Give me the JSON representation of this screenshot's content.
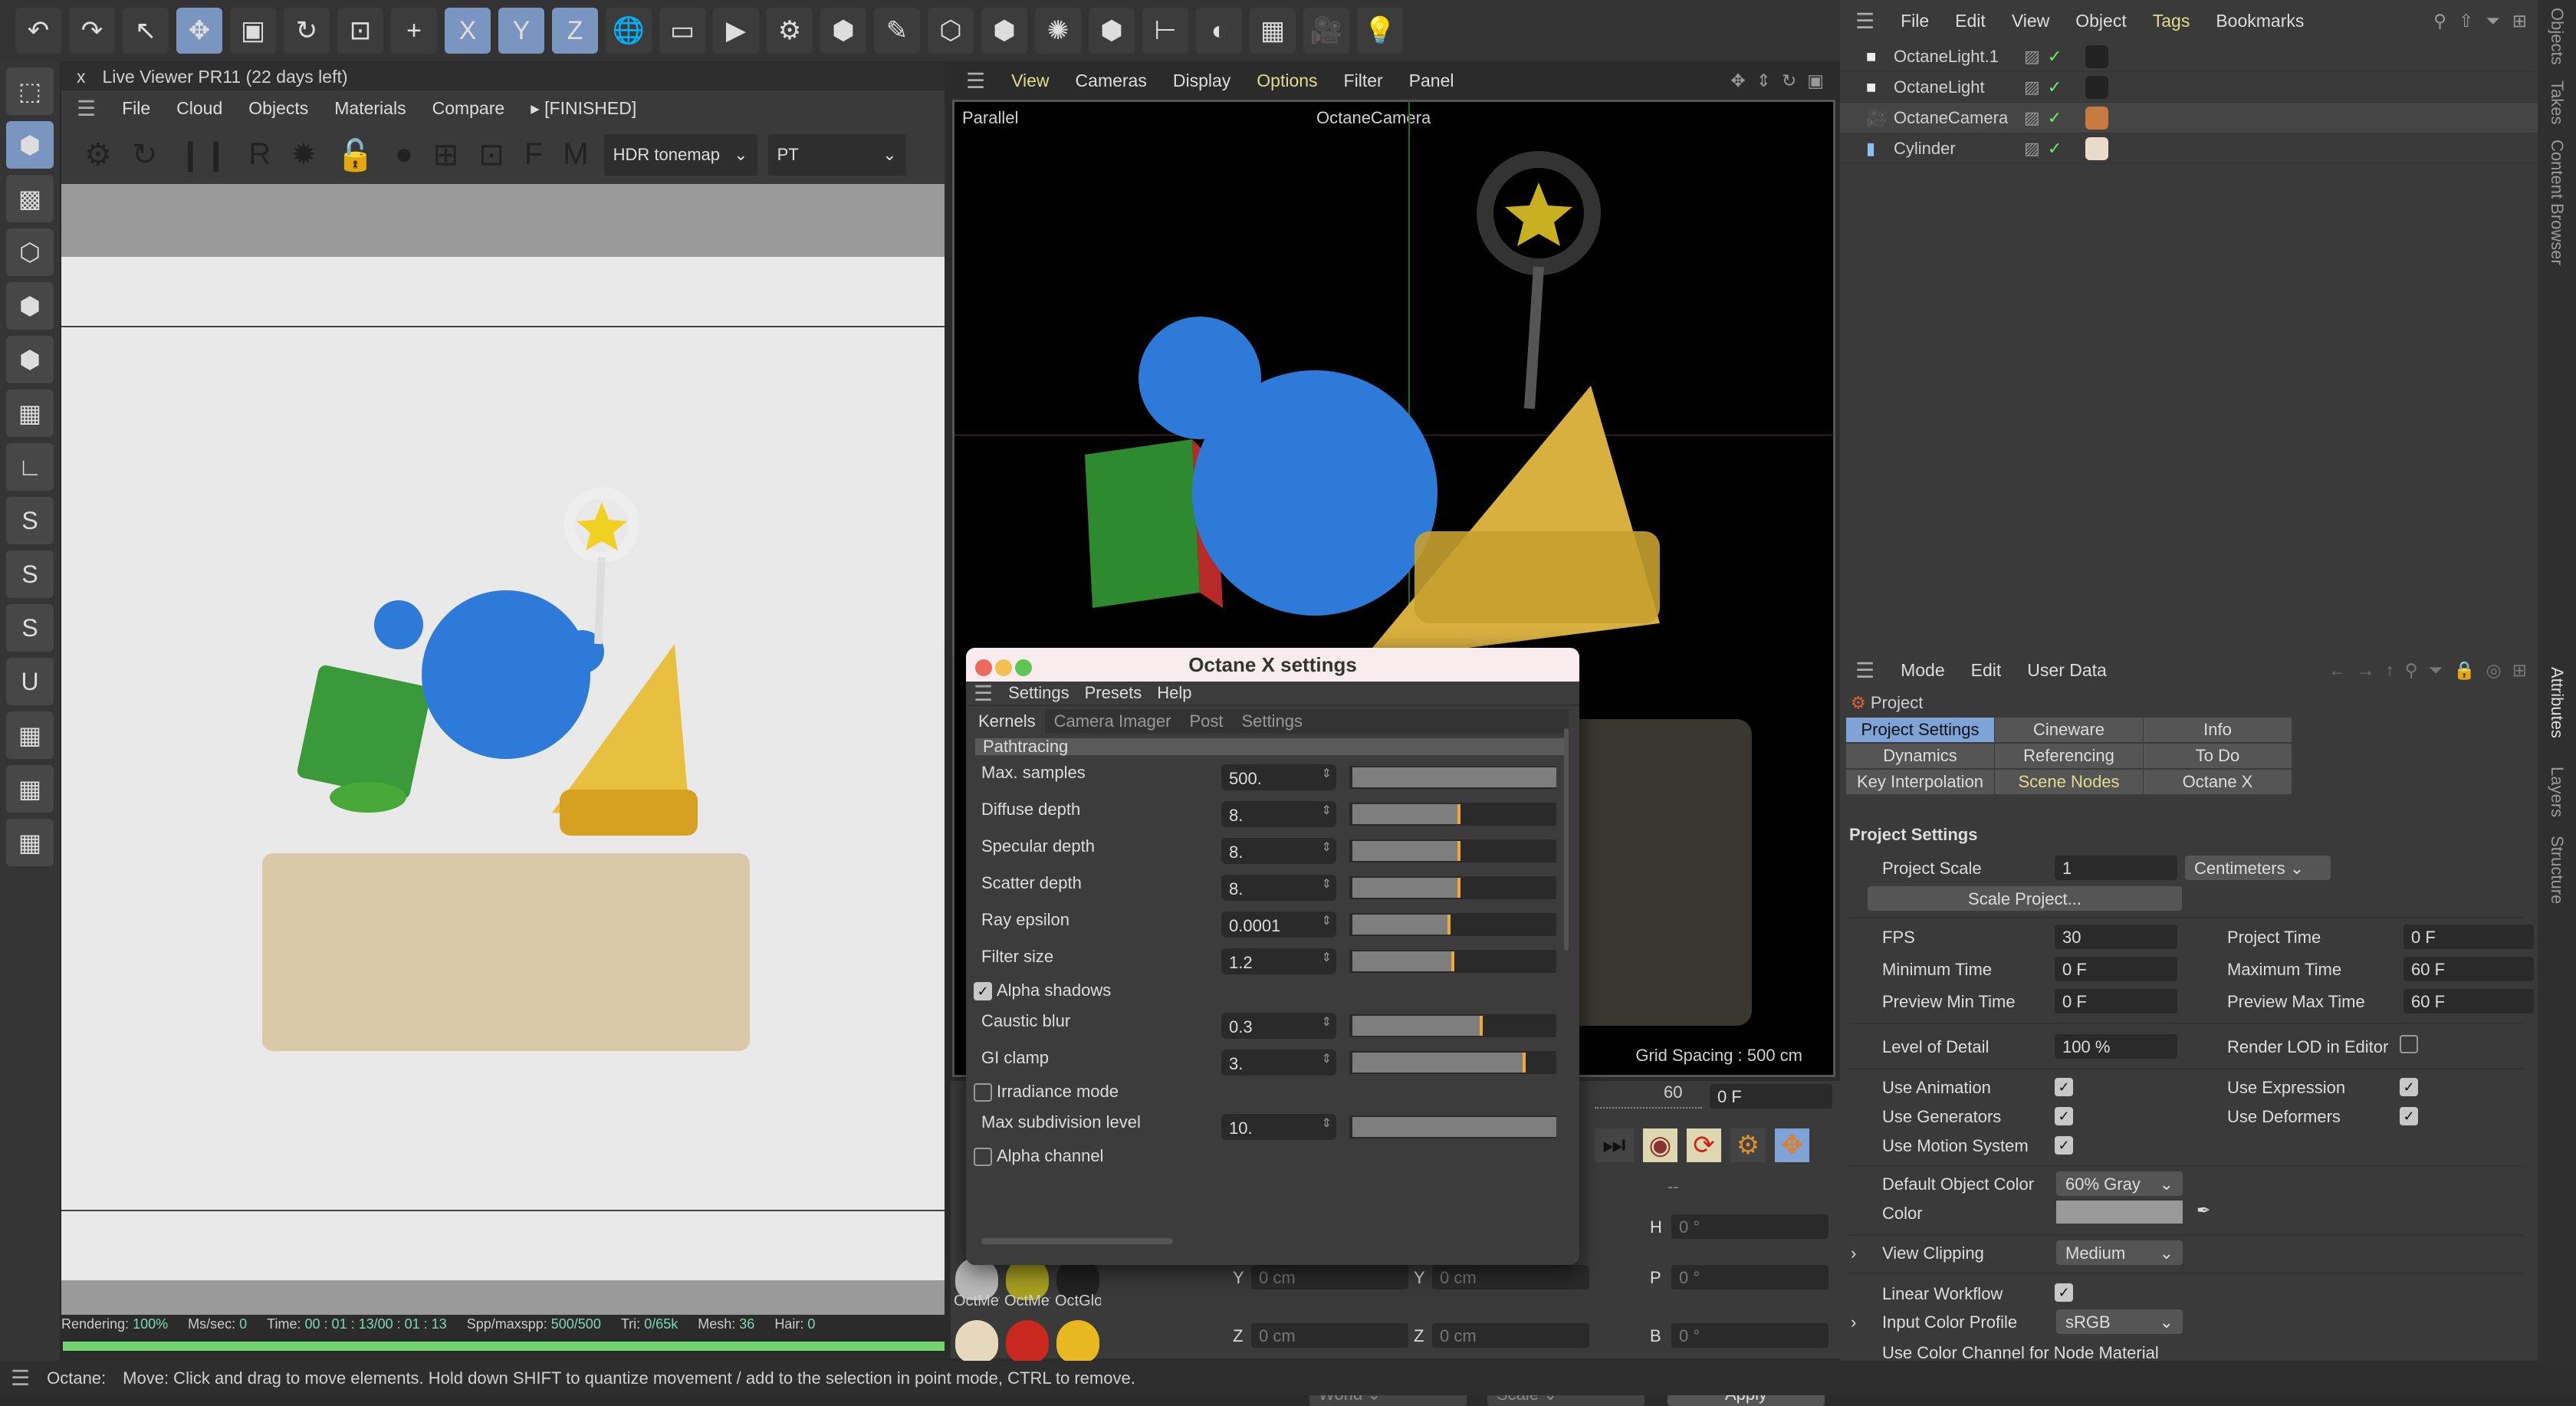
{
  "top_toolbar": {
    "icons": [
      "undo-icon",
      "redo-icon",
      "select-icon",
      "move-icon",
      "scale-icon",
      "rotate-icon",
      "recent-tools-icon",
      "create-icon",
      "x-axis-icon",
      "y-axis-icon",
      "z-axis-icon",
      "world-coords-icon",
      "render-view-icon",
      "render-icon",
      "render-settings-icon",
      "cube-icon",
      "pen-icon",
      "sds-icon",
      "extrude-icon",
      "cloner-icon",
      "mograph-icon",
      "bend-icon",
      "field-icon",
      "floor-icon",
      "camera-icon",
      "light-icon"
    ],
    "glyphs": [
      "↶",
      "↷",
      "↖",
      "✥",
      "▣",
      "↻",
      "⊡",
      "+",
      "X",
      "Y",
      "Z",
      "🌐",
      "▭",
      "▶",
      "⚙",
      "⬢",
      "✎",
      "⬡",
      "⬢",
      "✺",
      "⬢",
      "⊢",
      "◐",
      "▦",
      "🎥",
      "💡"
    ]
  },
  "left_tools": {
    "icons": [
      "make-editable-icon",
      "model-mode-icon",
      "texture-mode-icon",
      "points-mode-icon",
      "edges-mode-icon",
      "polygons-mode-icon",
      "uv-mode-icon",
      "axis-icon",
      "snap-icon",
      "snap-settings-icon",
      "snap-workplane-icon",
      "magnet-icon",
      "workplane-icon",
      "lock-workplane-icon",
      "grid-icon"
    ],
    "glyphs": [
      "⬚",
      "⬢",
      "▩",
      "⬡",
      "⬢",
      "⬢",
      "▦",
      "∟",
      "S",
      "S",
      "S",
      "U",
      "▦",
      "▦",
      "▦"
    ]
  },
  "live_viewer": {
    "title": "Live Viewer PR11 (22 days left)",
    "close": "x",
    "menu": [
      "File",
      "Cloud",
      "Objects",
      "Materials",
      "Compare"
    ],
    "state": "[FINISHED]",
    "tools": [
      "⚙",
      "↻",
      "❙❙",
      "R",
      "✹",
      "🔓",
      "●",
      "⊞",
      "⊡",
      "F",
      "M"
    ],
    "tonemap": "HDR tonemap",
    "kernel": "PT",
    "stats": {
      "rendering_label": "Rendering:",
      "rendering": "100%",
      "mssec_label": "Ms/sec:",
      "mssec": "0",
      "time_label": "Time:",
      "time": "00 : 01 : 13/00 : 01 : 13",
      "spp_label": "Spp/maxspp:",
      "spp": "500/500",
      "tri_label": "Tri:",
      "tri": "0/65k",
      "mesh_label": "Mesh:",
      "mesh": "36",
      "hair_label": "Hair:",
      "hair": "0"
    },
    "progress": 1.0
  },
  "viewport": {
    "menu": [
      "View",
      "Cameras",
      "Display",
      "Options",
      "Filter",
      "Panel"
    ],
    "projection": "Parallel",
    "camera": "OctaneCamera",
    "grid_spacing": "Grid Spacing : 500 cm"
  },
  "timeline": {
    "frame_end": "60",
    "current": "0 F",
    "dash": "--"
  },
  "coords": {
    "rows": [
      {
        "a": "Y",
        "av": "0 cm",
        "b": "Y",
        "bv": "0 cm",
        "c": "P",
        "cv": "0 °"
      },
      {
        "a": "Z",
        "av": "0 cm",
        "b": "Z",
        "bv": "0 cm",
        "c": "B",
        "cv": "0 °"
      }
    ],
    "h_label": "H",
    "h_value": "0 °",
    "world": "World",
    "scale": "Scale",
    "apply": "Apply"
  },
  "materials": {
    "names": [
      "OctMeta",
      "OctMeta",
      "OctGlos"
    ],
    "colors": [
      "#b8b8b8",
      "#a8a020",
      "#222222",
      "#e6d8bc",
      "#c8281e",
      "#e8b820"
    ]
  },
  "dialog": {
    "title": "Octane X settings",
    "menu": [
      "Settings",
      "Presets",
      "Help"
    ],
    "tabs": [
      "Kernels",
      "Camera Imager",
      "Post",
      "Settings"
    ],
    "section": "Pathtracing",
    "rows": [
      {
        "label": "Max. samples",
        "value": "500.",
        "level": 1.0,
        "marker": false
      },
      {
        "label": "Diffuse depth",
        "value": "8.",
        "level": 0.53,
        "marker": true
      },
      {
        "label": "Specular depth",
        "value": "8.",
        "level": 0.53,
        "marker": true
      },
      {
        "label": "Scatter depth",
        "value": "8.",
        "level": 0.53,
        "marker": true
      },
      {
        "label": "Ray epsilon",
        "value": "0.0001",
        "level": 0.48,
        "marker": true
      },
      {
        "label": "Filter size",
        "value": "1.2",
        "level": 0.5,
        "marker": true
      },
      {
        "label": "Alpha shadows",
        "checkbox": true,
        "checked": true
      },
      {
        "label": "Caustic blur",
        "value": "0.3",
        "level": 0.64,
        "marker": true
      },
      {
        "label": "GI clamp",
        "value": "3.",
        "level": 0.85,
        "marker": true
      },
      {
        "label": "Irradiance mode",
        "checkbox": true,
        "checked": false
      },
      {
        "label": "Max subdivision level",
        "value": "10.",
        "level": 1.0,
        "marker": false
      },
      {
        "label": "Alpha channel",
        "checkbox": true,
        "checked": false
      }
    ]
  },
  "object_manager": {
    "menu": [
      "File",
      "Edit",
      "View",
      "Object",
      "Tags",
      "Bookmarks"
    ],
    "objects": [
      {
        "name": "OctaneLight.1",
        "icon": "light-icon"
      },
      {
        "name": "OctaneLight",
        "icon": "light-icon"
      },
      {
        "name": "OctaneCamera",
        "icon": "camera-icon"
      },
      {
        "name": "Cylinder",
        "icon": "cylinder-icon"
      }
    ]
  },
  "right_tabs": [
    "Objects",
    "Takes",
    "Content Browser",
    "Attributes",
    "Layers",
    "Structure"
  ],
  "attributes": {
    "menu": [
      "Mode",
      "Edit",
      "User Data"
    ],
    "object": "Project",
    "tabs": [
      "Project Settings",
      "Cineware",
      "Info",
      "Dynamics",
      "Referencing",
      "To Do",
      "Key Interpolation",
      "Scene Nodes",
      "Octane X"
    ],
    "section": "Project Settings",
    "project_scale_label": "Project Scale",
    "project_scale": "1",
    "unit": "Centimeters",
    "scale_project": "Scale Project...",
    "fps_label": "FPS",
    "fps": "30",
    "project_time_label": "Project Time",
    "project_time": "0 F",
    "min_time_label": "Minimum Time",
    "min_time": "0 F",
    "max_time_label": "Maximum Time",
    "max_time": "60 F",
    "prev_min_label": "Preview Min Time",
    "prev_min": "0 F",
    "prev_max_label": "Preview Max Time",
    "prev_max": "60 F",
    "lod_label": "Level of Detail",
    "lod": "100 %",
    "render_lod_label": "Render LOD in Editor",
    "use_animation": "Use Animation",
    "use_expression": "Use Expression",
    "use_generators": "Use Generators",
    "use_deformers": "Use Deformers",
    "use_motion": "Use Motion System",
    "default_color_label": "Default Object Color",
    "default_color": "60% Gray",
    "color_label": "Color",
    "color_value": "#999999",
    "view_clipping_label": "View Clipping",
    "view_clipping": "Medium",
    "linear_workflow": "Linear Workflow",
    "input_profile_label": "Input Color Profile",
    "input_profile": "sRGB",
    "use_color_channel": "Use Color Channel for Node Material"
  },
  "status_bar": {
    "prefix": "Octane:",
    "message": "Move: Click and drag to move elements. Hold down SHIFT to quantize movement / add to the selection in point mode, CTRL to remove."
  }
}
